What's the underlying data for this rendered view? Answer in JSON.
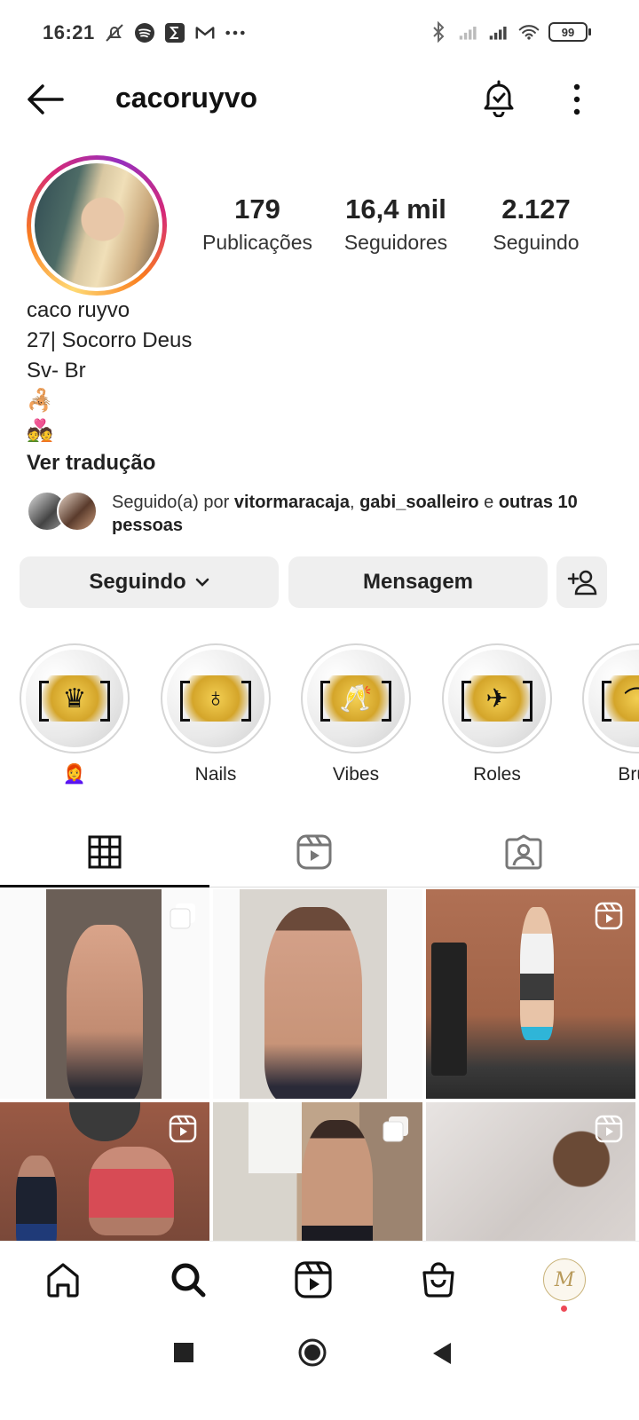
{
  "status_bar": {
    "time": "16:21",
    "battery": "99",
    "left_icons": [
      "mute-icon",
      "spotify-icon",
      "sigma-icon",
      "gmail-icon",
      "more-dots-icon"
    ],
    "right_icons": [
      "bluetooth-icon",
      "signal-icon",
      "signal-icon",
      "wifi-icon",
      "battery-icon"
    ]
  },
  "header": {
    "username": "cacoruyvo"
  },
  "profile": {
    "stats": [
      {
        "value": "179",
        "label": "Publicações"
      },
      {
        "value": "16,4 mil",
        "label": "Seguidores"
      },
      {
        "value": "2.127",
        "label": "Seguindo"
      }
    ],
    "name": "caco ruyvo",
    "bio_lines": [
      "27| Socorro Deus",
      "Sv- Br"
    ],
    "bio_emojis": [
      "🦂",
      "💑"
    ],
    "translate": "Ver tradução",
    "followed_by": {
      "prefix": "Seguido(a) por ",
      "user1": "vitormaracaja",
      "sep": ", ",
      "user2": "gabi_soalleiro",
      "connector": " e ",
      "others": "outras 10 pessoas"
    }
  },
  "actions": {
    "following": "Seguindo",
    "message": "Mensagem"
  },
  "highlights": [
    {
      "label": "👩‍🦰",
      "icon": "crown-icon",
      "glyph": "♛"
    },
    {
      "label": "Nails",
      "icon": "nail-polish-icon",
      "glyph": "♁"
    },
    {
      "label": "Vibes",
      "icon": "cheers-icon",
      "glyph": "🥂"
    },
    {
      "label": "Roles",
      "icon": "airplane-icon",
      "glyph": "✈"
    },
    {
      "label": "Brus",
      "icon": "hanger-icon",
      "glyph": "⌒"
    }
  ],
  "tabs": [
    "grid-icon",
    "reels-icon",
    "tagged-icon"
  ],
  "bottom_nav": [
    "home-icon",
    "search-icon",
    "reels-icon",
    "shop-icon",
    "profile-avatar"
  ],
  "profile_avatar_letter": "M"
}
